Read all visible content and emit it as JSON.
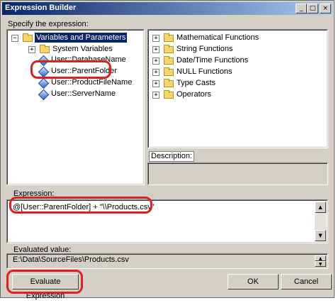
{
  "window": {
    "title": "Expression Builder",
    "minimize_glyph": "_",
    "maximize_glyph": "□",
    "close_glyph": "×"
  },
  "specify_label": "Specify the expression:",
  "variables_tree": {
    "root": "Variables and Parameters",
    "items": [
      "System Variables",
      "User::DatabaseName",
      "User::ParentFolder",
      "User::ProductFileName",
      "User::ServerName"
    ]
  },
  "functions_tree": {
    "items": [
      "Mathematical Functions",
      "String Functions",
      "Date/Time Functions",
      "NULL Functions",
      "Type Casts",
      "Operators"
    ]
  },
  "description_label": "Description:",
  "expression_label": "Expression:",
  "expression_value": "@[User::ParentFolder] + \"\\\\Products.csv\"",
  "evaluated_label": "Evaluated value:",
  "evaluated_value": "E:\\Data\\SourceFiles\\Products.csv",
  "buttons": {
    "evaluate": "Evaluate Expression",
    "ok": "OK",
    "cancel": "Cancel"
  },
  "icons": [
    "folder-icon",
    "variable-icon",
    "expand-icon",
    "collapse-icon"
  ],
  "colors": {
    "title_bar": "#0a246a",
    "selection": "#0a246a",
    "highlight_oval": "#e02020",
    "dialog_bg": "#d4d0c8"
  }
}
